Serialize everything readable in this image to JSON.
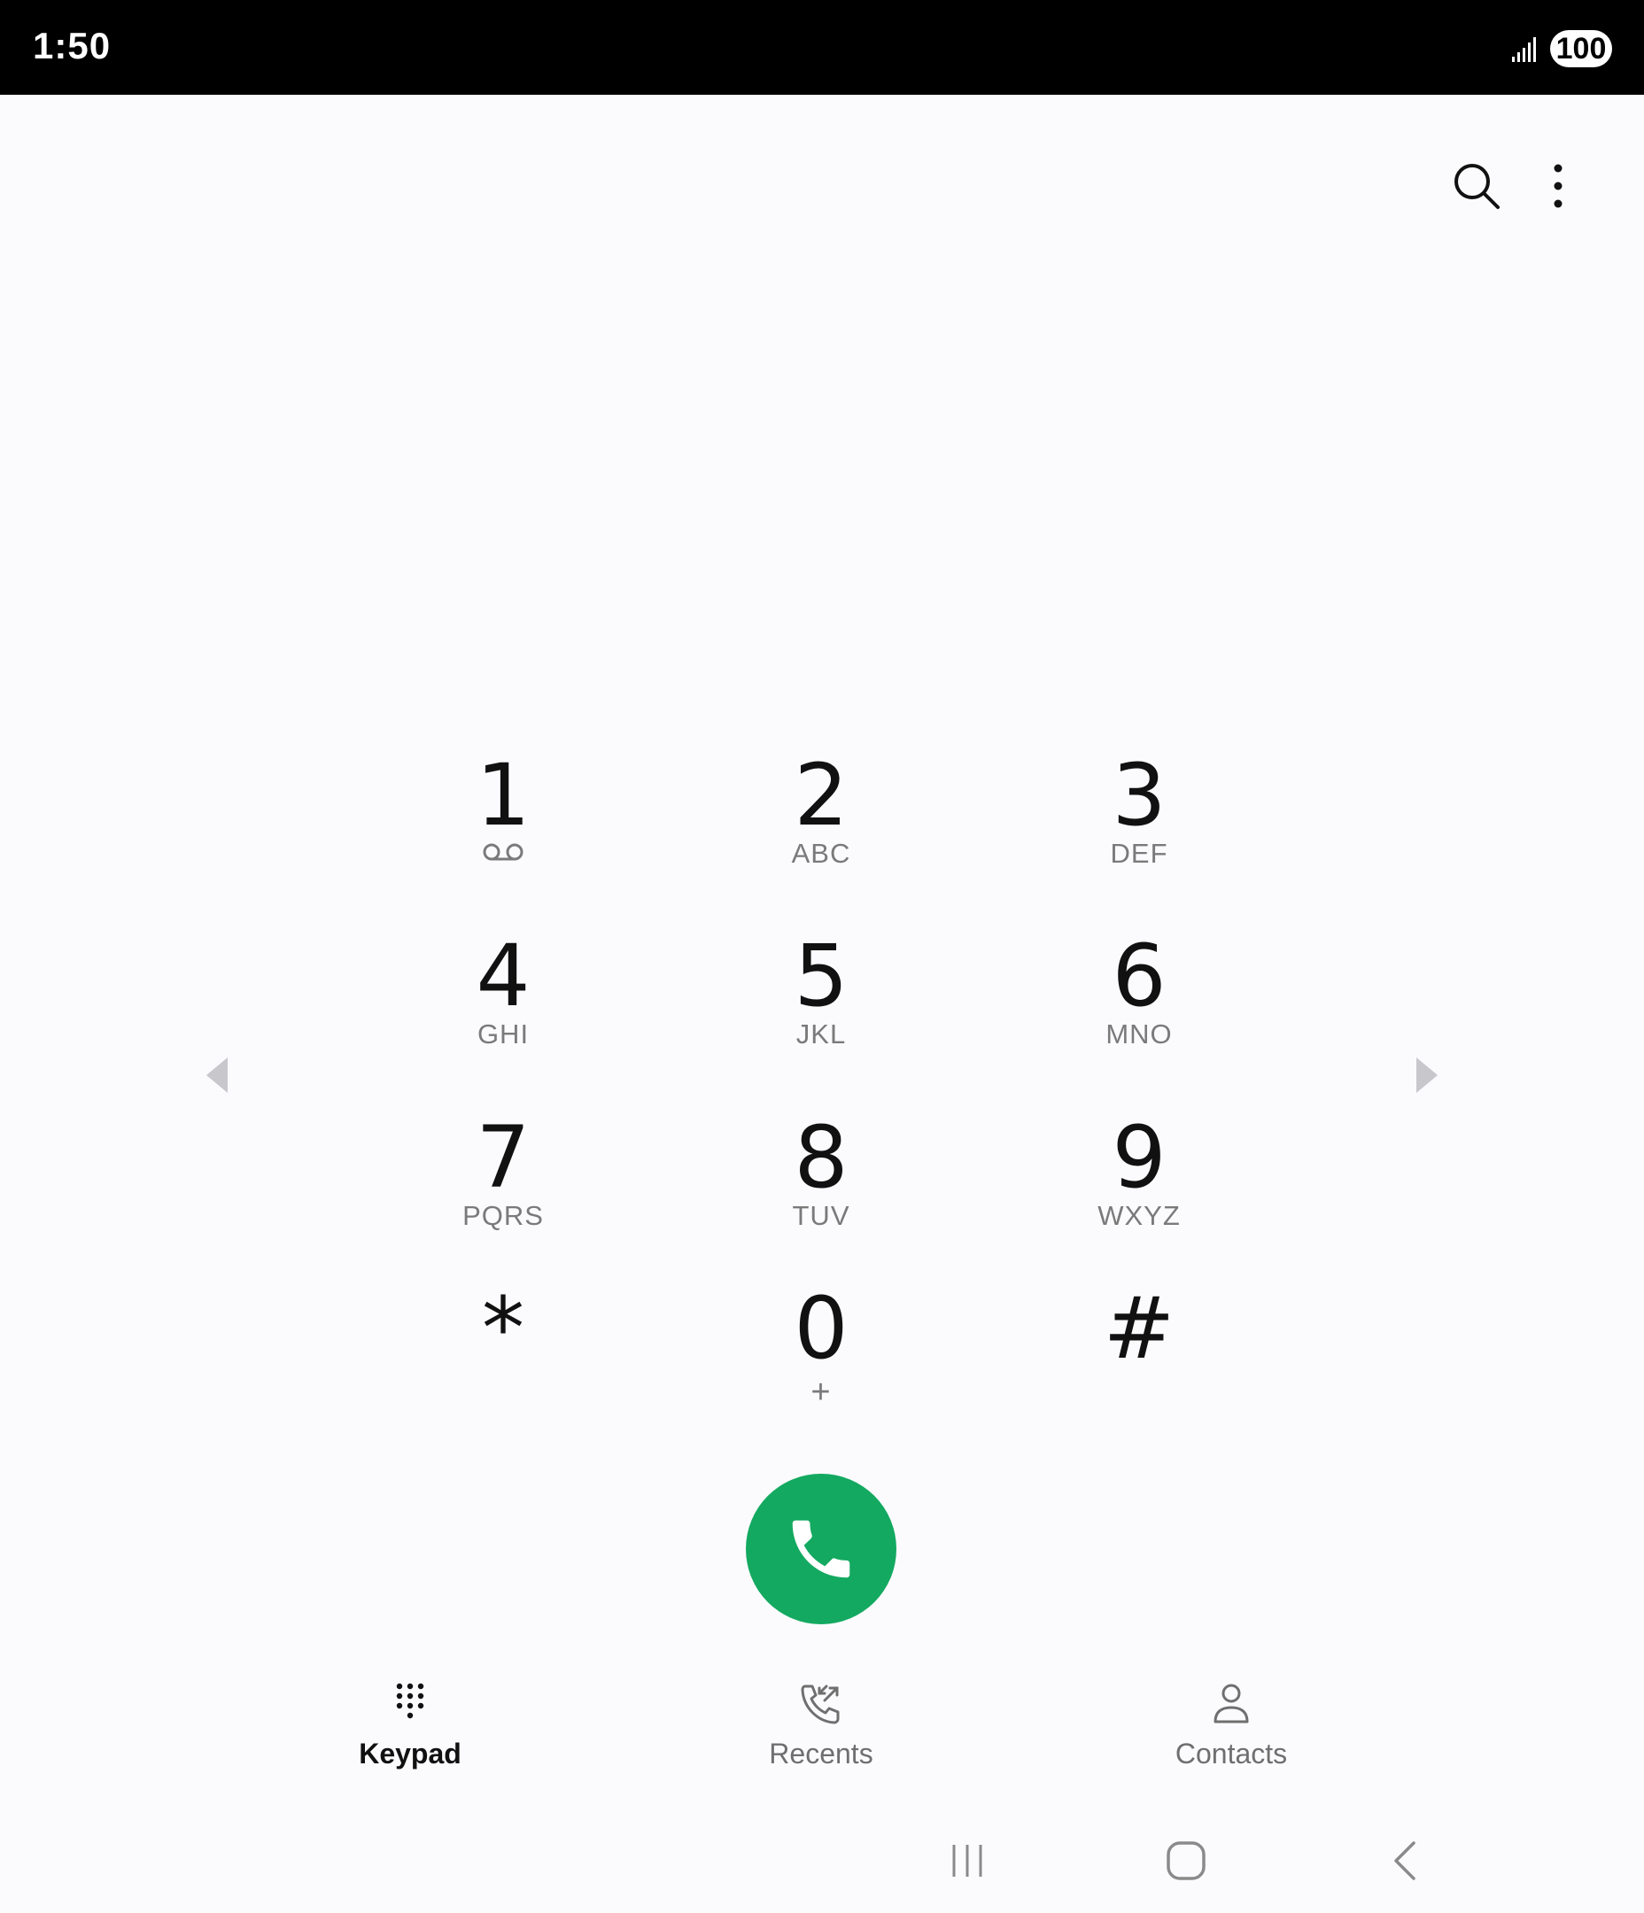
{
  "status_bar": {
    "time": "1:50",
    "battery": "100",
    "signal_icon": "signal-bars-icon"
  },
  "toolbar": {
    "search_icon": "search-icon",
    "more_icon": "more-vertical-icon"
  },
  "keypad": {
    "keys": [
      {
        "digit": "1",
        "letters": "",
        "sub_icon": "voicemail-icon"
      },
      {
        "digit": "2",
        "letters": "ABC"
      },
      {
        "digit": "3",
        "letters": "DEF"
      },
      {
        "digit": "4",
        "letters": "GHI"
      },
      {
        "digit": "5",
        "letters": "JKL"
      },
      {
        "digit": "6",
        "letters": "MNO"
      },
      {
        "digit": "7",
        "letters": "PQRS"
      },
      {
        "digit": "8",
        "letters": "TUV"
      },
      {
        "digit": "9",
        "letters": "WXYZ"
      },
      {
        "digit": "*",
        "letters": ""
      },
      {
        "digit": "0",
        "letters": "+"
      },
      {
        "digit": "#",
        "letters": ""
      }
    ],
    "left_arrow_icon": "arrow-left-icon",
    "right_arrow_icon": "arrow-right-icon"
  },
  "call": {
    "icon": "phone-icon",
    "color": "#13a960"
  },
  "bottom_nav": {
    "tabs": [
      {
        "label": "Keypad",
        "icon": "keypad-icon",
        "active": true
      },
      {
        "label": "Recents",
        "icon": "recents-icon",
        "active": false
      },
      {
        "label": "Contacts",
        "icon": "contacts-icon",
        "active": false
      }
    ]
  },
  "system_nav": {
    "recents_icon": "recent-apps-icon",
    "home_icon": "home-icon",
    "back_icon": "back-icon"
  }
}
